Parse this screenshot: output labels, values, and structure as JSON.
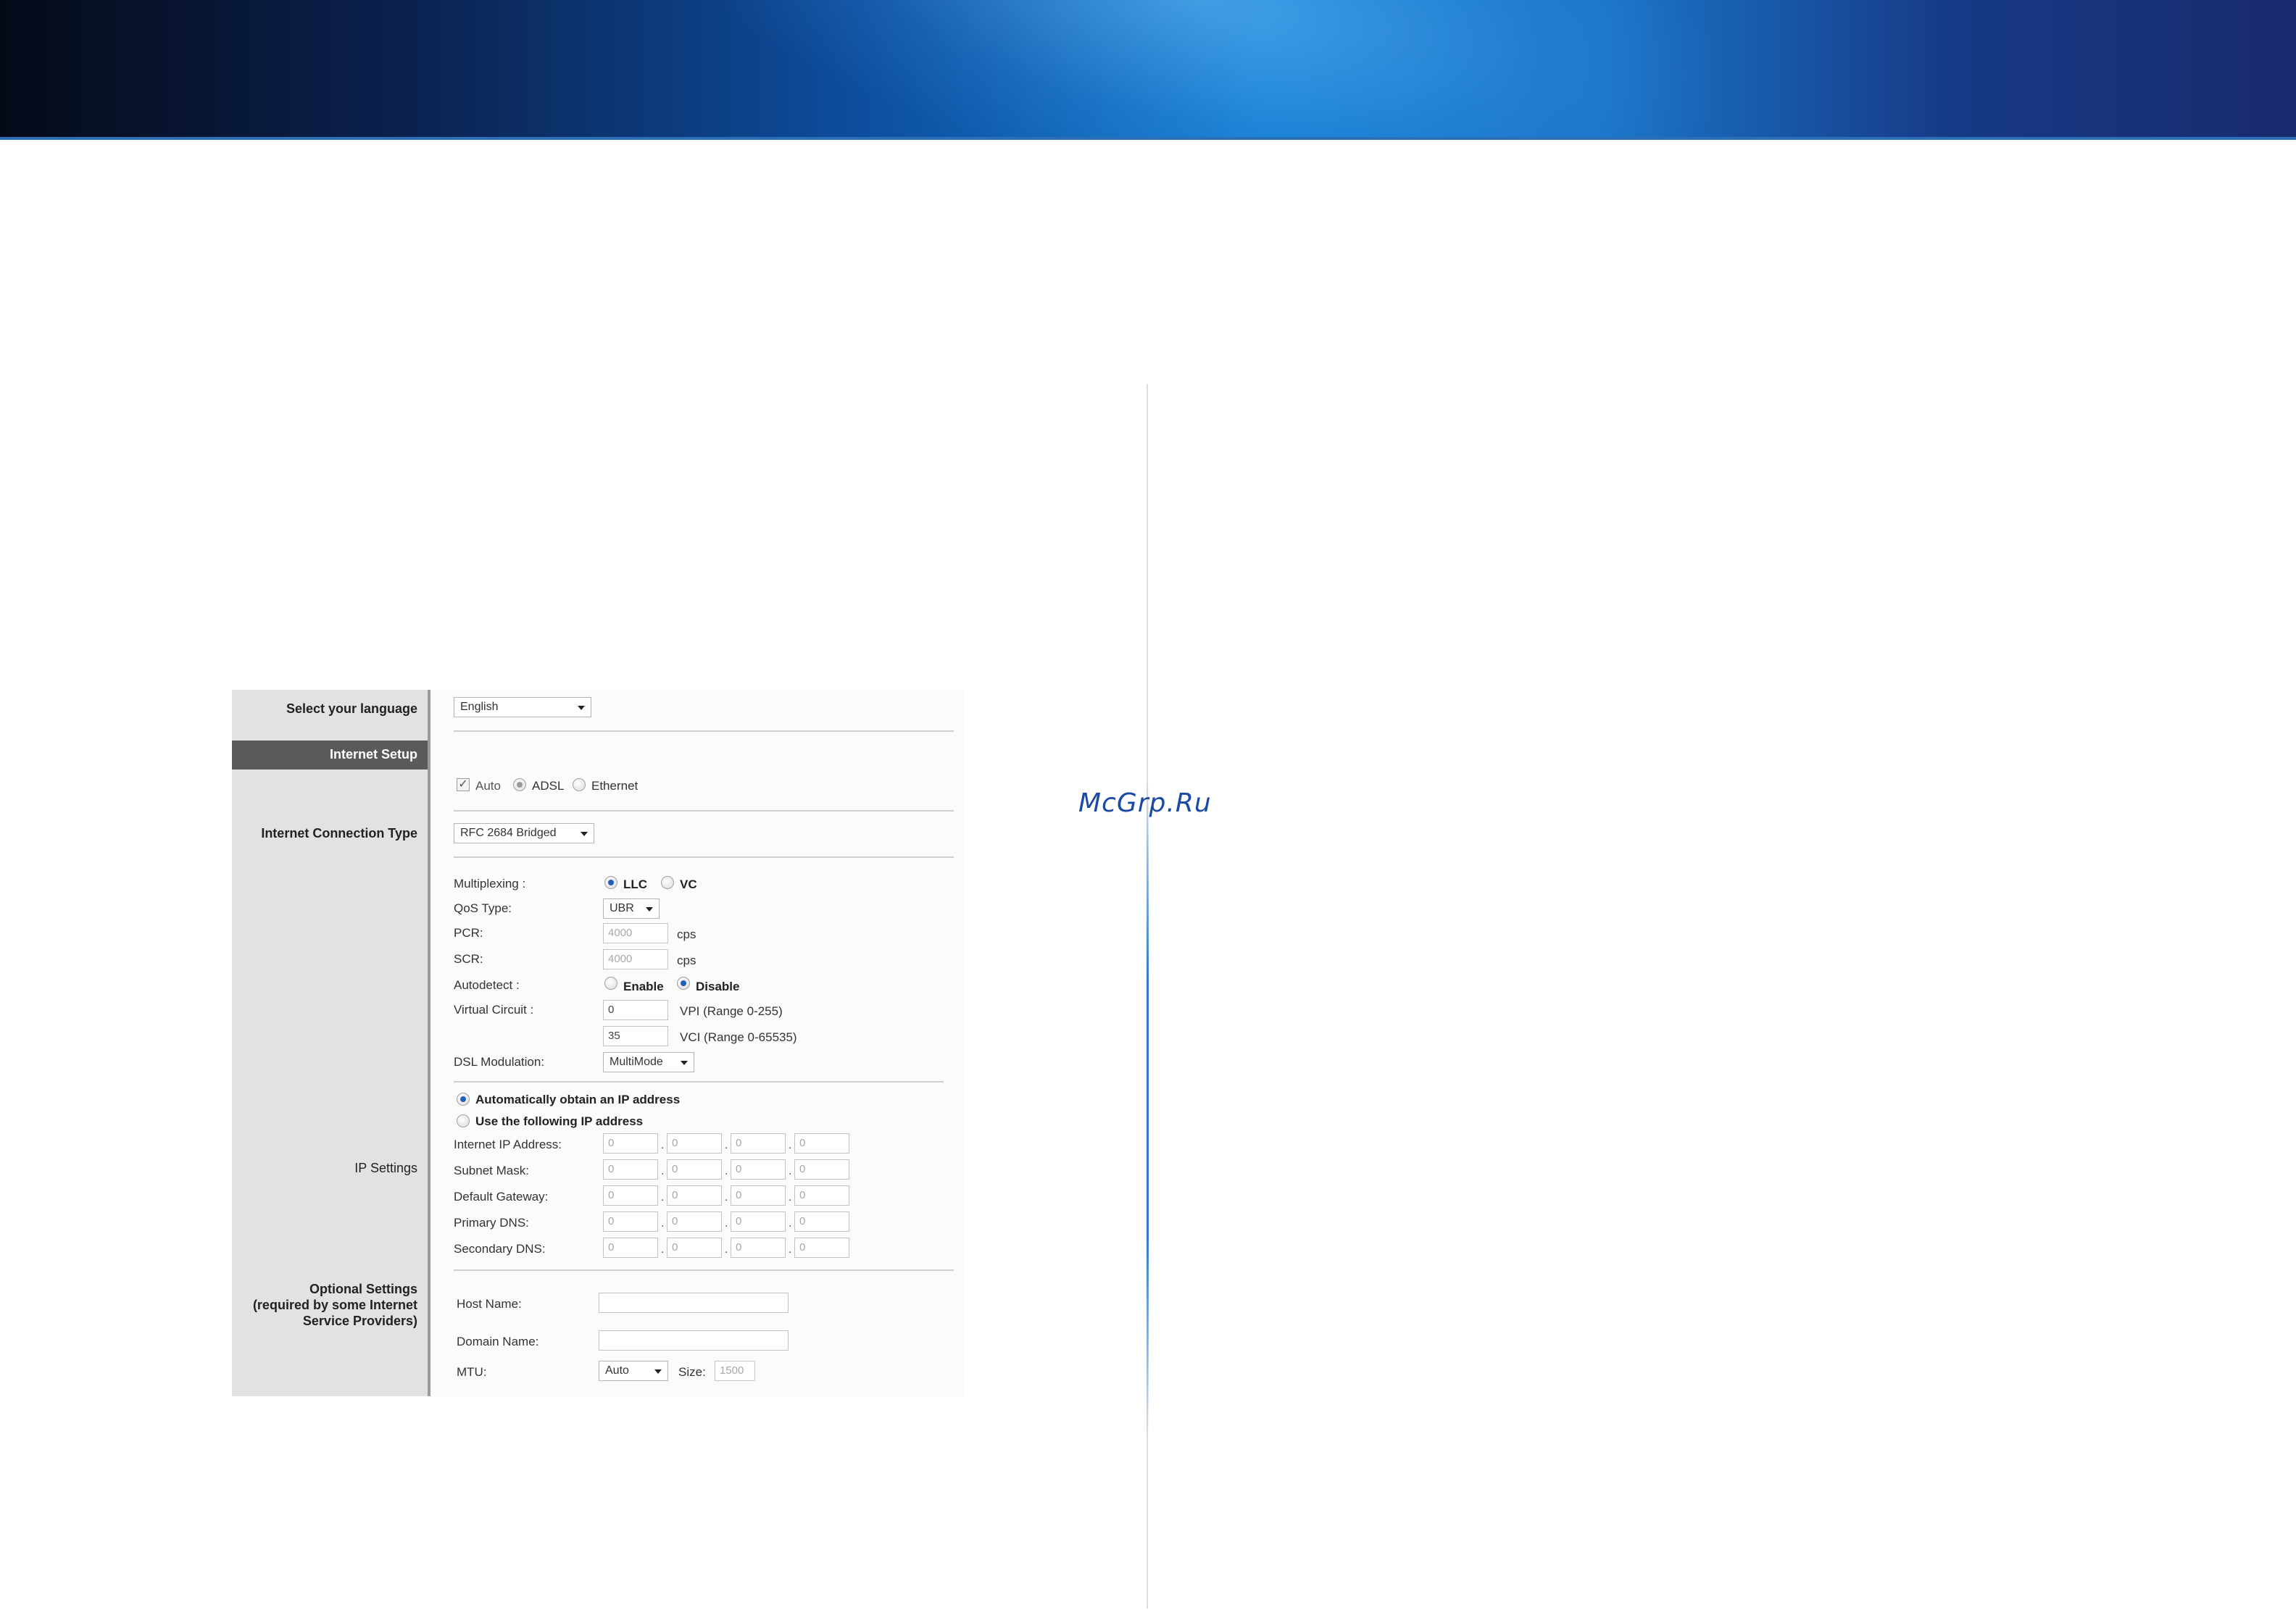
{
  "watermark": "McGrp.Ru",
  "sidebar": {
    "language_label": "Select your language",
    "internet_setup": "Internet Setup",
    "connection_type_label": "Internet Connection Type",
    "ip_settings_label": "IP Settings",
    "optional_line1": "Optional Settings",
    "optional_line2": "(required by some Internet",
    "optional_line3": "Service Providers)"
  },
  "language": {
    "selected": "English"
  },
  "detect": {
    "auto": "Auto",
    "adsl": "ADSL",
    "ethernet": "Ethernet",
    "check_mark": "✓"
  },
  "connection_type": {
    "selected": "RFC 2684 Bridged"
  },
  "multiplexing": {
    "label": "Multiplexing :",
    "llc": "LLC",
    "vc": "VC"
  },
  "qos": {
    "label": "QoS Type:",
    "selected": "UBR",
    "pcr_label": "PCR:",
    "pcr_value": "4000",
    "pcr_unit": "cps",
    "scr_label": "SCR:",
    "scr_value": "4000",
    "scr_unit": "cps"
  },
  "autodetect": {
    "label": "Autodetect :",
    "enable": "Enable",
    "disable": "Disable"
  },
  "virtual_circuit": {
    "label": "Virtual Circuit :",
    "vpi_value": "0",
    "vpi_hint": "VPI (Range 0-255)",
    "vci_value": "35",
    "vci_hint": "VCI (Range 0-65535)"
  },
  "dsl_modulation": {
    "label": "DSL Modulation:",
    "selected": "MultiMode"
  },
  "ip_mode": {
    "auto": "Automatically obtain an IP address",
    "static": "Use the following IP address"
  },
  "ip_fields": [
    {
      "label": "Internet IP Address:",
      "octets": [
        "0",
        "0",
        "0",
        "0"
      ]
    },
    {
      "label": "Subnet Mask:",
      "octets": [
        "0",
        "0",
        "0",
        "0"
      ]
    },
    {
      "label": "Default Gateway:",
      "octets": [
        "0",
        "0",
        "0",
        "0"
      ]
    },
    {
      "label": "Primary DNS:",
      "octets": [
        "0",
        "0",
        "0",
        "0"
      ]
    },
    {
      "label": "Secondary DNS:",
      "octets": [
        "0",
        "0",
        "0",
        "0"
      ]
    }
  ],
  "octet_separator": ".",
  "optional": {
    "host_label": "Host Name:",
    "host_value": "",
    "domain_label": "Domain Name:",
    "domain_value": "",
    "mtu_label": "MTU:",
    "mtu_selected": "Auto",
    "size_label": "Size:",
    "size_value": "1500"
  }
}
